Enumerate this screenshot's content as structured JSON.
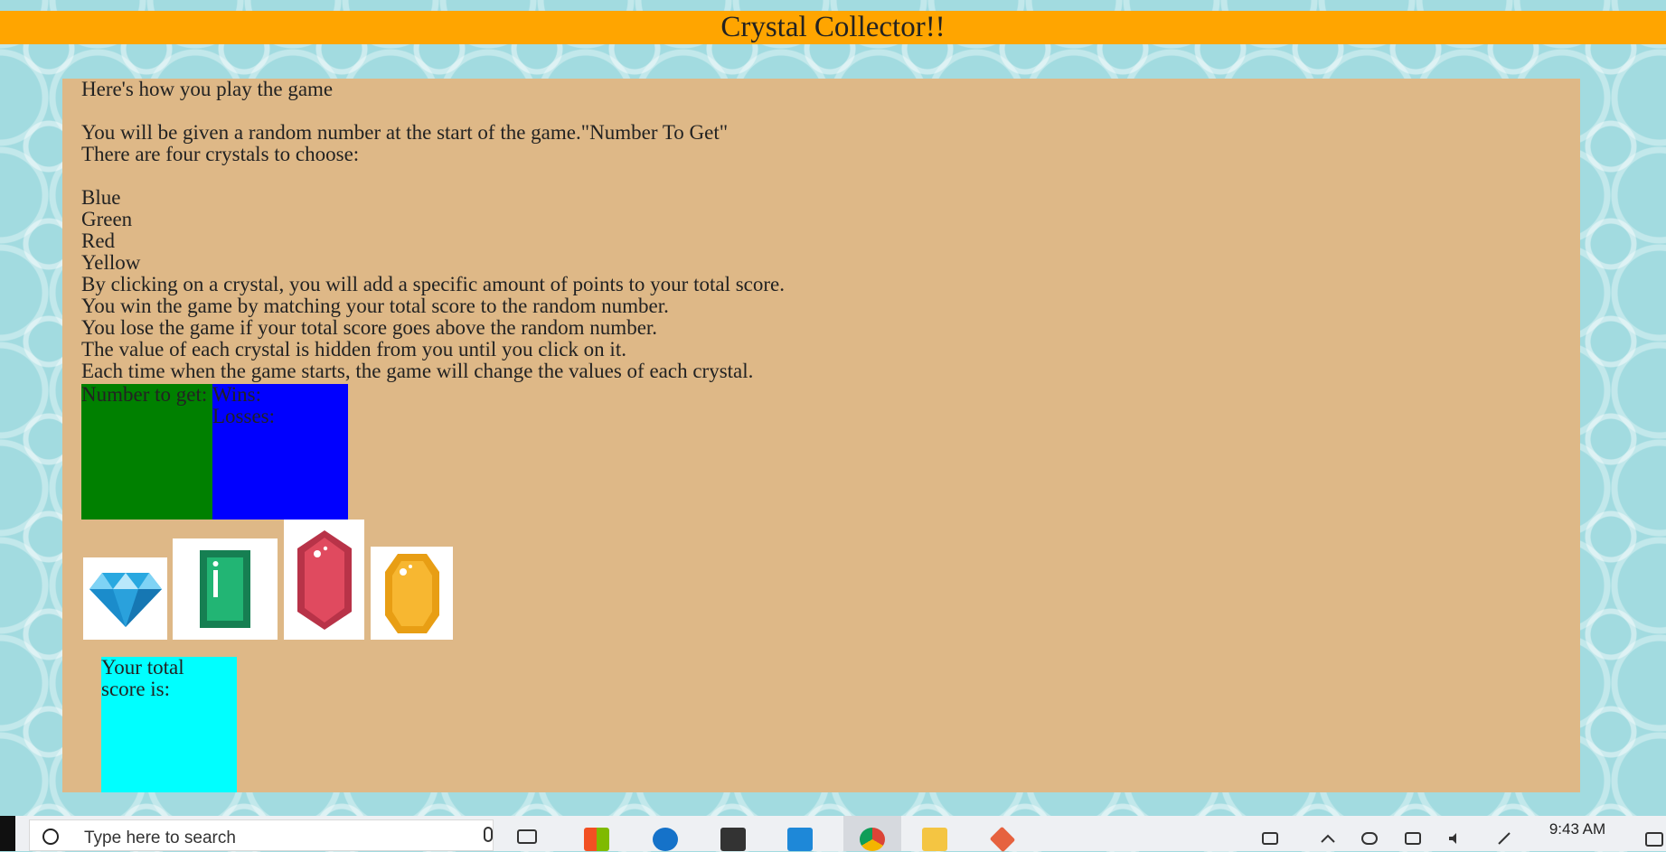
{
  "banner": {
    "title": "Crystal Collector!!"
  },
  "instructions": {
    "intro": "Here's how you play the game",
    "line1": "You will be given a random number at the start of the game.\"Number To Get\"",
    "line2": "There are four crystals to choose:",
    "colors": [
      "Blue",
      "Green",
      "Red",
      "Yellow"
    ],
    "rules": [
      "By clicking on a crystal, you will add a specific amount of points to your total score.",
      "You win the game by matching your total score to the random number.",
      "You lose the game if your total score goes above the random number.",
      "The value of each crystal is hidden from you until you click on it.",
      "Each time when the game starts, the game will change the values of each crystal."
    ]
  },
  "target": {
    "label": "Number to get:"
  },
  "record": {
    "wins_label": "Wins:",
    "losses_label": "Losses:"
  },
  "crystals": [
    {
      "name": "blue-diamond-crystal",
      "color": "#29a8e0"
    },
    {
      "name": "green-emerald-crystal",
      "color": "#1fa36a"
    },
    {
      "name": "red-ruby-crystal",
      "color": "#e04a5f"
    },
    {
      "name": "yellow-topaz-crystal",
      "color": "#f7b731"
    }
  ],
  "score": {
    "label_line1": "Your total",
    "label_line2": "score is:"
  },
  "taskbar": {
    "search_placeholder": "Type here to search",
    "time": "9:43 AM"
  },
  "colors": {
    "banner": "#ffa500",
    "panel": "#deb887",
    "target_box": "#008000",
    "record_box": "#0000ff",
    "score_box": "#00ffff",
    "page_bg": "#a2dbe0"
  }
}
